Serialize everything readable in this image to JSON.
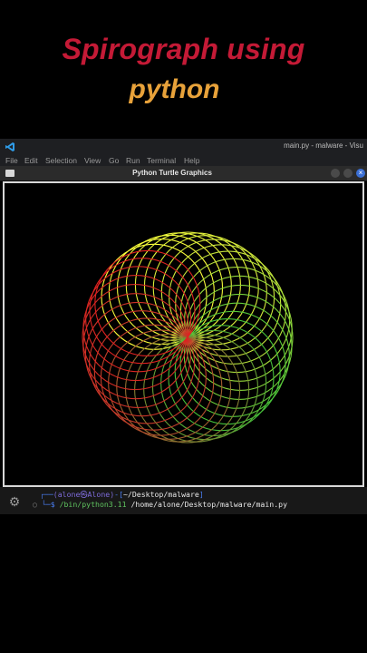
{
  "headline": {
    "title": "Spirograph using",
    "subtitle": "python",
    "title_color": "#c41a36",
    "subtitle_color": "#e8a23a"
  },
  "vscode": {
    "window_title": "main.py - malware - Visu",
    "menu": [
      "File",
      "Edit",
      "Selection",
      "View",
      "Go",
      "Run",
      "Terminal",
      "Help"
    ]
  },
  "turtle_window": {
    "title": "Python Turtle Graphics",
    "close_label": "×"
  },
  "spirograph": {
    "circle_count": 36,
    "colors": [
      "#ffff3a",
      "#c8e43a",
      "#3ec43a",
      "#c43a2a",
      "#e02020"
    ],
    "background": "#000000"
  },
  "terminal": {
    "prompt_user": "(alone㉿Alone)",
    "prompt_path": "~/Desktop/malware",
    "command_interpreter": "/bin/python3.11",
    "command_args": "/home/alone/Desktop/malware/main.py"
  }
}
